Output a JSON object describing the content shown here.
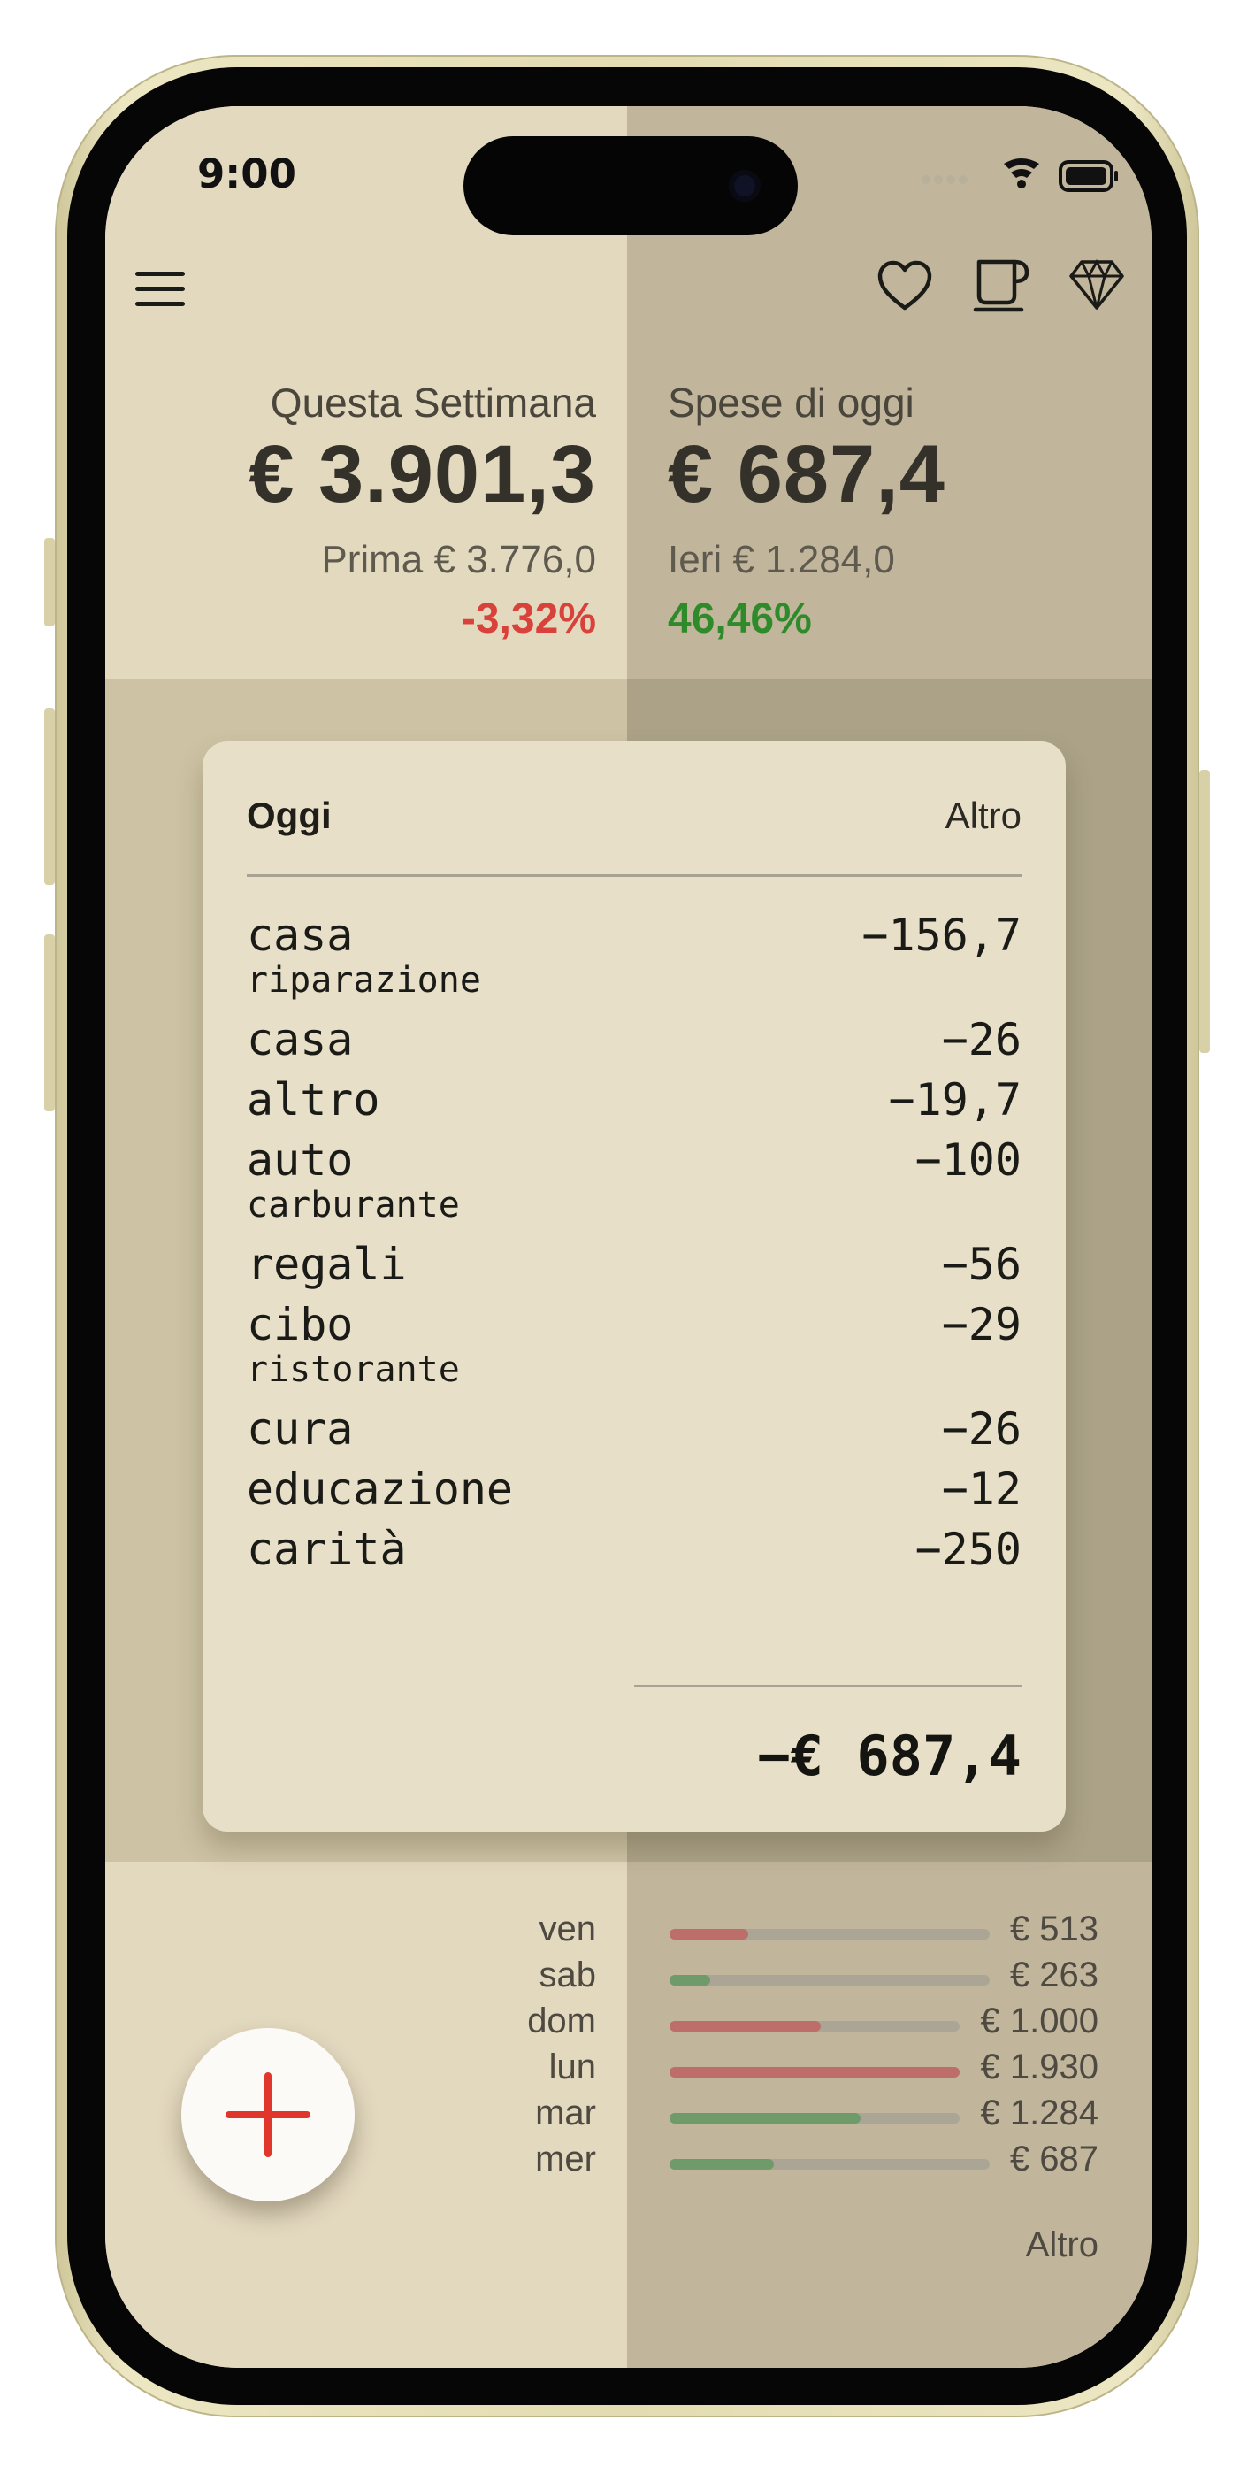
{
  "status": {
    "time": "9:00"
  },
  "colors": {
    "negative": "#d8423a",
    "positive": "#2f8a2a",
    "bar_up": "#bd6e6a",
    "bar_down": "#6f9a6a",
    "fab_plus": "#e0362b"
  },
  "toolbar": {
    "menu_icon": "hamburger-menu-icon",
    "heart_icon": "heart-icon",
    "cup_icon": "coffee-cup-icon",
    "gem_icon": "diamond-icon"
  },
  "summary": {
    "week": {
      "label": "Questa Settimana",
      "value": "€ 3.901,3",
      "previous": "Prima € 3.776,0",
      "change": "-3,32%"
    },
    "today": {
      "label": "Spese di oggi",
      "value": "€ 687,4",
      "previous": "Ieri € 1.284,0",
      "change": "46,46%"
    }
  },
  "card": {
    "title": "Oggi",
    "more": "Altro",
    "items": [
      {
        "category": "casa",
        "subcategory": "riparazione",
        "amount": "−156,7"
      },
      {
        "category": "casa",
        "subcategory": "",
        "amount": "−26"
      },
      {
        "category": "altro",
        "subcategory": "",
        "amount": "−19,7"
      },
      {
        "category": "auto",
        "subcategory": "carburante",
        "amount": "−100"
      },
      {
        "category": "regali",
        "subcategory": "",
        "amount": "−56"
      },
      {
        "category": "cibo",
        "subcategory": "ristorante",
        "amount": "−29"
      },
      {
        "category": "cura",
        "subcategory": "",
        "amount": "−26"
      },
      {
        "category": "educazione",
        "subcategory": "",
        "amount": "−12"
      },
      {
        "category": "carità",
        "subcategory": "",
        "amount": "−250"
      }
    ],
    "total": "−€ 687,4"
  },
  "weekly": {
    "days": [
      {
        "day": "ven",
        "amount": "€ 513",
        "fraction": 0.27,
        "trend": "up"
      },
      {
        "day": "sab",
        "amount": "€ 263",
        "fraction": 0.14,
        "trend": "down"
      },
      {
        "day": "dom",
        "amount": "€ 1.000",
        "fraction": 0.52,
        "trend": "up"
      },
      {
        "day": "lun",
        "amount": "€ 1.930",
        "fraction": 1.0,
        "trend": "up"
      },
      {
        "day": "mar",
        "amount": "€ 1.284",
        "fraction": 0.66,
        "trend": "down"
      },
      {
        "day": "mer",
        "amount": "€ 687",
        "fraction": 0.36,
        "trend": "down"
      }
    ],
    "more": "Altro"
  },
  "fab": {
    "icon": "plus-icon"
  }
}
